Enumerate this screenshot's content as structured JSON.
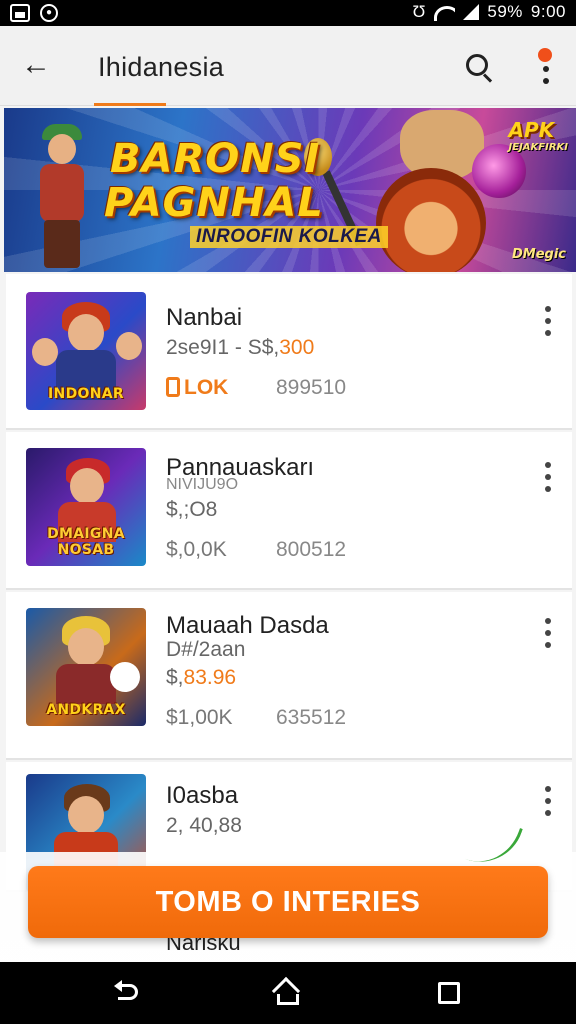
{
  "status_bar": {
    "battery": "59%",
    "time": "9:00"
  },
  "header": {
    "title": "Ihidanesia",
    "back_icon": "arrow-left-icon",
    "search_icon": "search-icon",
    "menu_icon": "more-vertical-icon"
  },
  "banner": {
    "title_line1": "BARONSI",
    "title_line2": "PAGNHAL",
    "subtitle": "INROOFIN KOLKEA",
    "tag": "APK",
    "tag_small": "JEJAKFIRKI",
    "corner": "DMegic"
  },
  "items": [
    {
      "title": "Nanbai",
      "line1_prefix": "2se9I1 - S$,",
      "line1_accent": "300",
      "line2": "",
      "badge": "LOK",
      "points": "899510",
      "thumb_label": "INDONAR"
    },
    {
      "title": "Pannauaskarı",
      "line1_prefix": "NIVIJU9O",
      "line1_accent": "",
      "line2": "$,;O8",
      "price": "$,0,0K",
      "points": "800512",
      "thumb_label": "DMAIGNA NOSAB"
    },
    {
      "title": "Mauaah Dasda",
      "line1_prefix": "D#/2aan",
      "line1_accent": "",
      "line2_prefix": "$,",
      "line2_accent": "83.96",
      "price": "$1,00K",
      "points": "635512",
      "thumb_label": "ANDKRAX"
    },
    {
      "title": "I0asba",
      "line1_prefix": "2, 40,88",
      "line1_accent": ""
    }
  ],
  "peek_item": {
    "title": "Narisku"
  },
  "cta": {
    "label": "TOMB O INTERIES"
  },
  "colors": {
    "accent": "#f07b1a",
    "cta": "#f56f0f"
  }
}
